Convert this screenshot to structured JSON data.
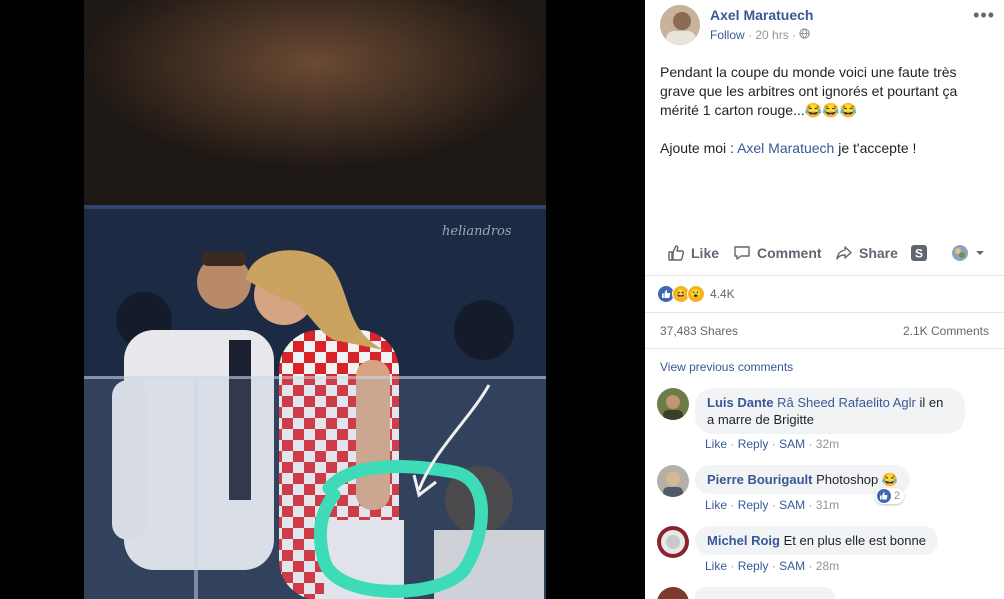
{
  "photo": {
    "watermark": "heliandros"
  },
  "post": {
    "author": "Axel Maratuech",
    "follow_label": "Follow",
    "time": "20 hrs",
    "text_main": "Pendant la coupe du monde voici une faute très grave que les arbitres ont ignorés et pourtant ça mérité 1 carton rouge...😂😂😂",
    "text_invite_prefix": "Ajoute moi :",
    "text_invite_link": "Axel Maratuech",
    "text_invite_suffix": "je t'accepte !"
  },
  "actions": {
    "like": "Like",
    "comment": "Comment",
    "share": "Share"
  },
  "stats": {
    "reactions_count": "4.4K",
    "shares": "37,483 Shares",
    "comments": "2.1K Comments"
  },
  "comments_section": {
    "view_previous": "View previous comments",
    "items": [
      {
        "name": "Luis Dante",
        "tags": "Râ Sheed Rafaelito Aglr",
        "text": "il en a marre de Brigitte",
        "like": "Like",
        "reply": "Reply",
        "sam": "SAM",
        "time": "32m"
      },
      {
        "name": "Pierre Bourigault",
        "text": "Photoshop 😂",
        "like": "Like",
        "reply": "Reply",
        "sam": "SAM",
        "time": "31m",
        "likes": "2"
      },
      {
        "name": "Michel Roig",
        "text": "Et en plus elle est bonne",
        "like": "Like",
        "reply": "Reply",
        "sam": "SAM",
        "time": "28m"
      }
    ]
  },
  "colors": {
    "link": "#385898",
    "muted": "#90949c",
    "bubble": "#f2f3f5"
  }
}
